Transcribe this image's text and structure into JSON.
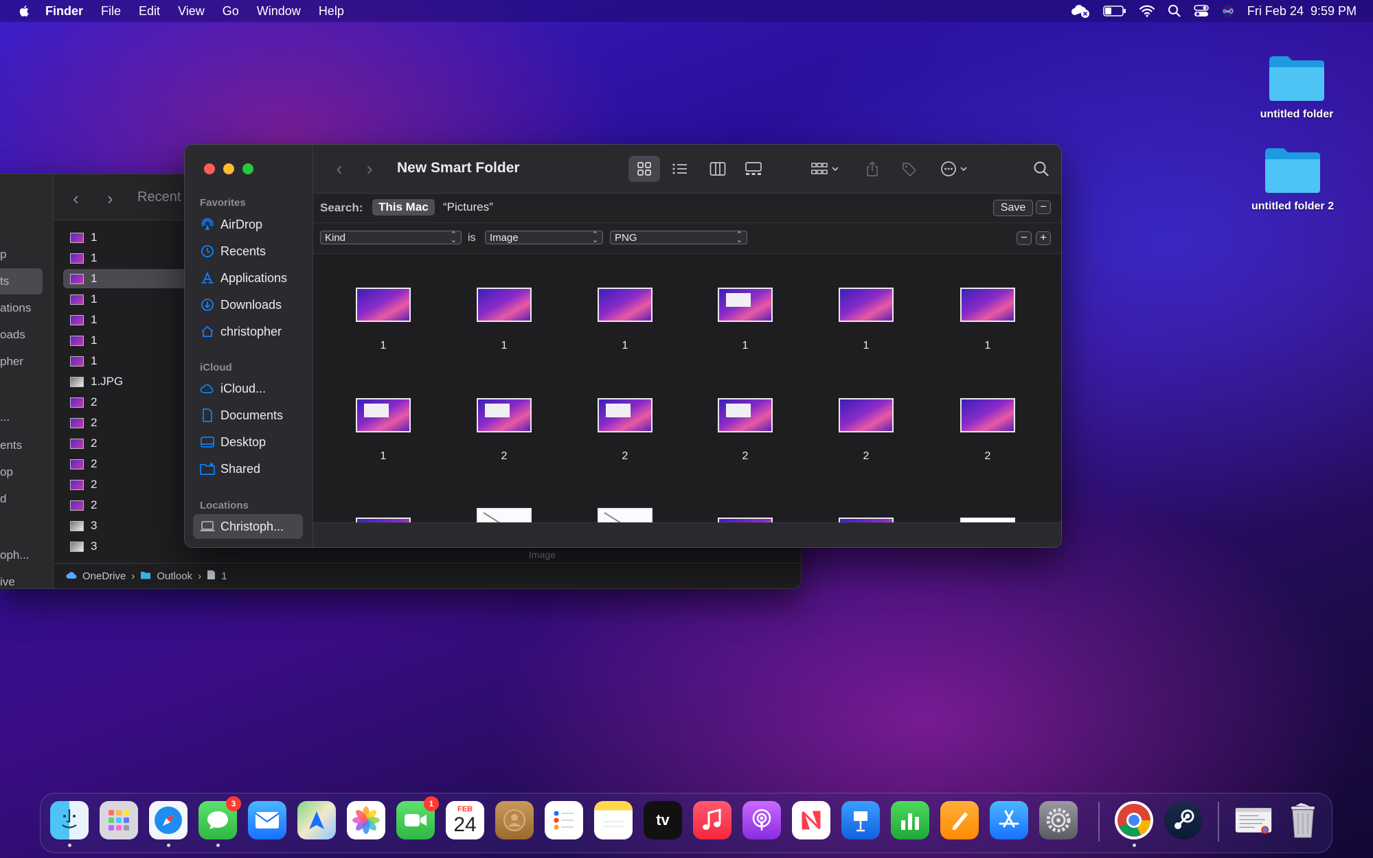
{
  "menubar": {
    "app": "Finder",
    "items": [
      "File",
      "Edit",
      "View",
      "Go",
      "Window",
      "Help"
    ],
    "datetime": "Fri Feb 24  9:59 PM"
  },
  "desktop": {
    "folders": [
      "untitled folder",
      "untitled folder 2"
    ]
  },
  "back_window": {
    "title": "Recent",
    "sidebar_fragments": [
      "p",
      "ts",
      "ations",
      "oads",
      "pher",
      "...",
      "ents",
      "op",
      "d",
      "oph...",
      "ive"
    ],
    "rows": [
      "1",
      "1",
      "1",
      "1",
      "1",
      "1",
      "1",
      "1.JPG",
      "2",
      "2",
      "2",
      "2",
      "2",
      "2",
      "3",
      "3"
    ],
    "selected_row": 2,
    "path": [
      "OneDrive",
      "Outlook",
      "1"
    ],
    "status": "Image"
  },
  "window": {
    "title": "New Smart Folder",
    "sidebar": {
      "favorites_header": "Favorites",
      "favorites": [
        "AirDrop",
        "Recents",
        "Applications",
        "Downloads",
        "christopher"
      ],
      "icloud_header": "iCloud",
      "icloud": [
        "iCloud...",
        "Documents",
        "Desktop",
        "Shared"
      ],
      "locations_header": "Locations",
      "locations": [
        "Christoph..."
      ]
    },
    "search": {
      "label": "Search:",
      "scope_on": "This Mac",
      "scope_off": "“Pictures”",
      "save_label": "Save"
    },
    "rule": {
      "attribute": "Kind",
      "operator": "is",
      "value": "Image",
      "subvalue": "PNG"
    },
    "items": [
      {
        "name": "1",
        "thumb": "wallpaper"
      },
      {
        "name": "1",
        "thumb": "wallpaper"
      },
      {
        "name": "1",
        "thumb": "wallpaper"
      },
      {
        "name": "1",
        "thumb": "screenshot"
      },
      {
        "name": "1",
        "thumb": "wallpaper"
      },
      {
        "name": "1",
        "thumb": "wallpaper"
      },
      {
        "name": "1",
        "thumb": "screenshot"
      },
      {
        "name": "2",
        "thumb": "screenshot"
      },
      {
        "name": "2",
        "thumb": "screenshot"
      },
      {
        "name": "2",
        "thumb": "screenshot"
      },
      {
        "name": "2",
        "thumb": "wallpaper"
      },
      {
        "name": "2",
        "thumb": "wallpaper"
      }
    ],
    "partial_row": [
      "screenshot",
      "white",
      "white",
      "screenshot",
      "screenshot",
      "orange"
    ]
  },
  "dock": {
    "apps": [
      "Finder",
      "Launchpad",
      "Safari",
      "Messages",
      "Mail",
      "Maps",
      "Photos",
      "FaceTime",
      "Calendar",
      "Contacts",
      "Reminders",
      "Notes",
      "TV",
      "Music",
      "Podcasts",
      "News",
      "Keynote",
      "Numbers",
      "Pages",
      "App Store",
      "System Settings",
      "Chrome",
      "Steam",
      "Preview",
      "Trash"
    ],
    "badges": {
      "messages": "3",
      "facetime": "1"
    },
    "calendar": {
      "month": "FEB",
      "day": "24"
    },
    "tv_label": "tv"
  },
  "colors": {
    "close": "#ff5f57",
    "minimize": "#febc2e",
    "zoom": "#28c840",
    "accent": "#0a84ff"
  }
}
